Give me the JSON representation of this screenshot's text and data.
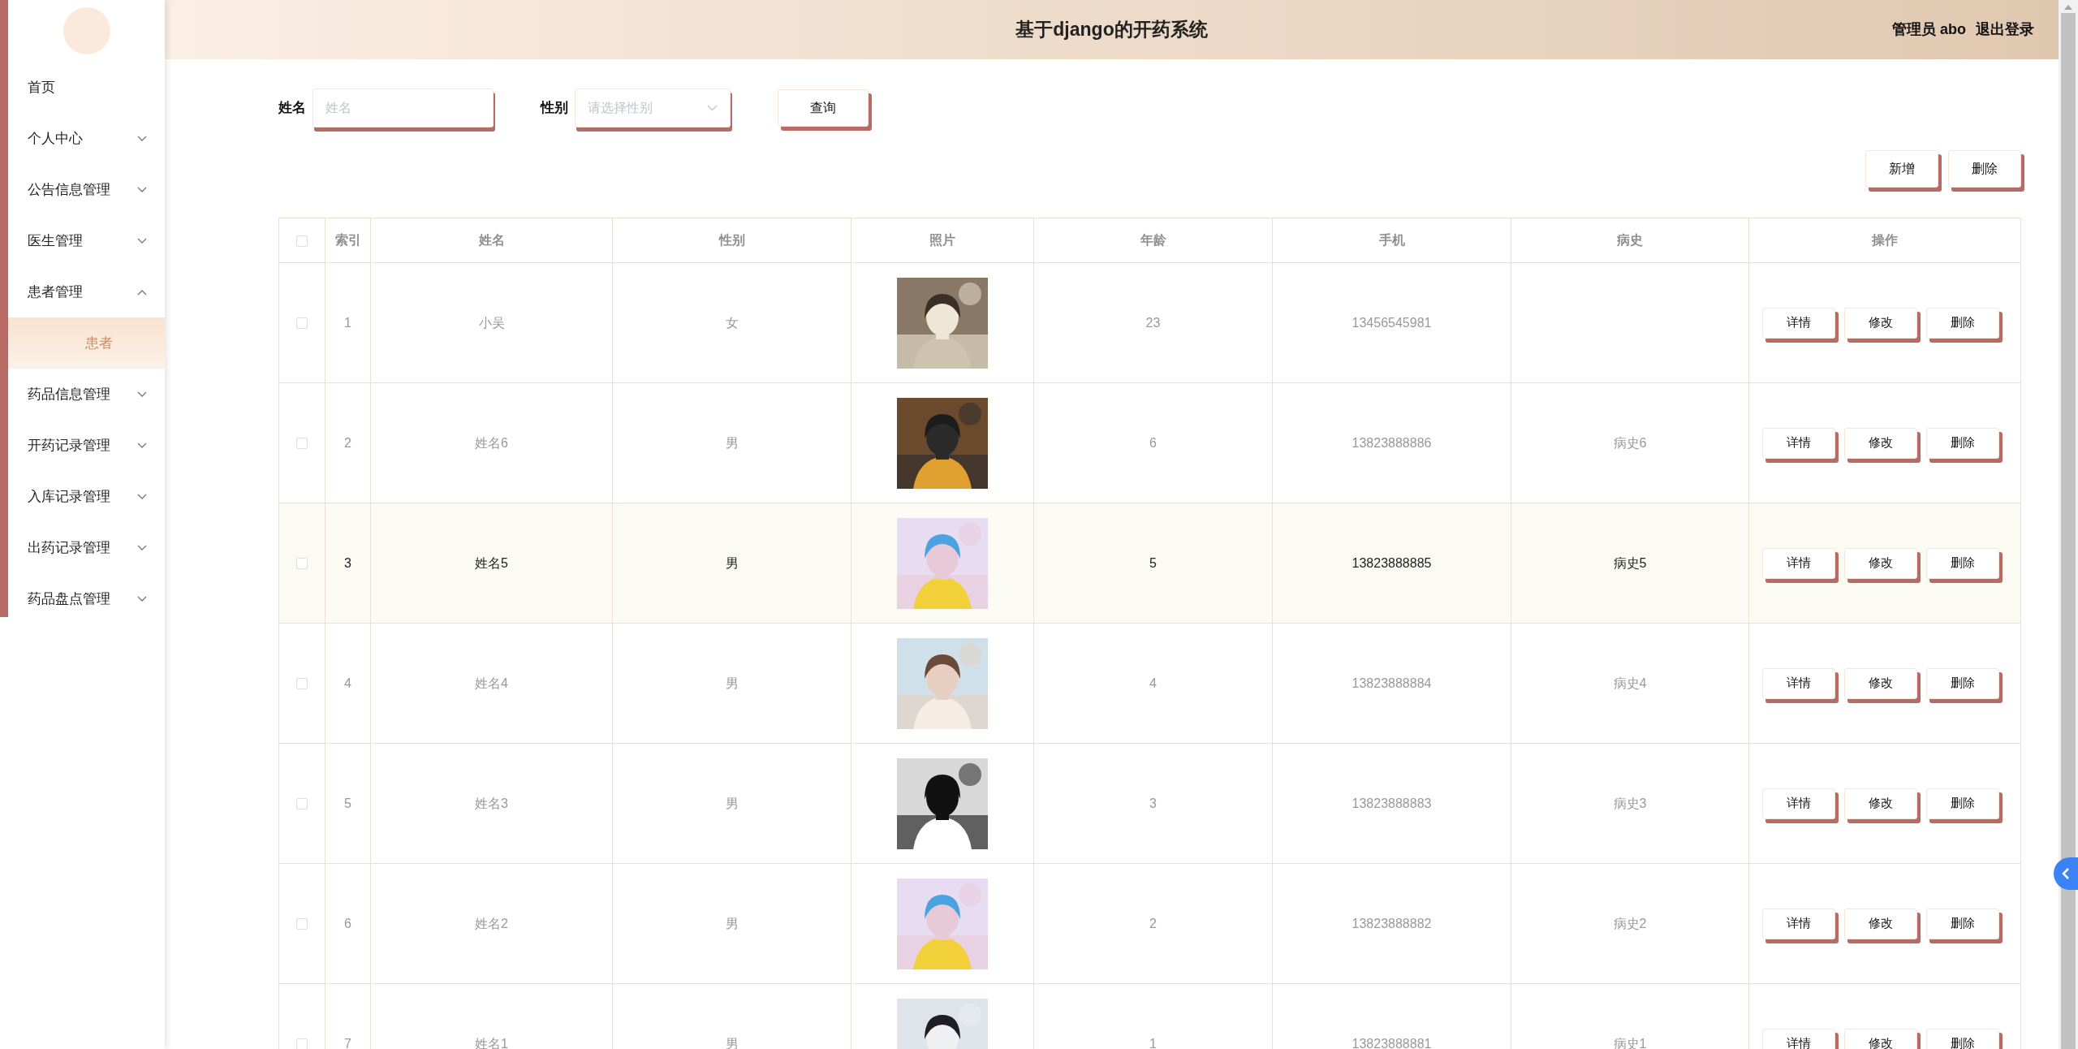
{
  "header": {
    "title": "基于django的开药系统",
    "user": "管理员 abo",
    "logout": "退出登录"
  },
  "sidebar": {
    "items": [
      {
        "label": "首页",
        "kind": "link"
      },
      {
        "label": "个人中心",
        "kind": "menu",
        "expanded": false
      },
      {
        "label": "公告信息管理",
        "kind": "menu",
        "expanded": false
      },
      {
        "label": "医生管理",
        "kind": "menu",
        "expanded": false
      },
      {
        "label": "患者管理",
        "kind": "menu",
        "expanded": true,
        "children": [
          {
            "label": "患者",
            "selected": true
          }
        ]
      },
      {
        "label": "药品信息管理",
        "kind": "menu",
        "expanded": false
      },
      {
        "label": "开药记录管理",
        "kind": "menu",
        "expanded": false
      },
      {
        "label": "入库记录管理",
        "kind": "menu",
        "expanded": false
      },
      {
        "label": "出药记录管理",
        "kind": "menu",
        "expanded": false
      },
      {
        "label": "药品盘点管理",
        "kind": "menu",
        "expanded": false
      }
    ]
  },
  "filters": [
    {
      "label": "姓名",
      "kind": "text",
      "placeholder": "姓名"
    },
    {
      "label": "性别",
      "kind": "select",
      "placeholder": "请选择性别"
    }
  ],
  "search_button": "查询",
  "actions": [
    "新增",
    "删除"
  ],
  "table": {
    "header_checked": false,
    "columns": [
      "索引",
      "姓名",
      "性别",
      "照片",
      "年龄",
      "手机",
      "病史",
      "操作"
    ],
    "rows": [
      {
        "checked": false,
        "hovered": false,
        "index": "1",
        "name": "小吴",
        "gender": "女",
        "age": "23",
        "phone": "13456545981",
        "buttons": [
          "详情",
          "修改",
          "删除"
        ]
      },
      {
        "checked": false,
        "hovered": false,
        "index": "2",
        "name": "姓名6",
        "gender": "男",
        "age": "6",
        "phone": "13823888886",
        "history": "病史6",
        "buttons": [
          "详情",
          "修改",
          "删除"
        ]
      },
      {
        "checked": false,
        "hovered": true,
        "index": "3",
        "name": "姓名5",
        "gender": "男",
        "age": "5",
        "phone": "13823888885",
        "history": "病史5",
        "buttons": [
          "详情",
          "修改",
          "删除"
        ]
      },
      {
        "checked": false,
        "hovered": false,
        "index": "4",
        "name": "姓名4",
        "gender": "男",
        "age": "4",
        "phone": "13823888884",
        "history": "病史4",
        "buttons": [
          "详情",
          "修改",
          "删除"
        ]
      },
      {
        "checked": false,
        "hovered": false,
        "index": "5",
        "name": "姓名3",
        "gender": "男",
        "age": "3",
        "phone": "13823888883",
        "history": "病史3",
        "buttons": [
          "详情",
          "修改",
          "删除"
        ]
      },
      {
        "checked": false,
        "hovered": false,
        "index": "6",
        "name": "姓名2",
        "gender": "男",
        "age": "2",
        "phone": "13823888882",
        "history": "病史2",
        "buttons": [
          "详情",
          "修改",
          "删除"
        ]
      },
      {
        "checked": false,
        "hovered": false,
        "index": "7",
        "name": "姓名1",
        "gender": "男",
        "age": "1",
        "phone": "13823888881",
        "history": "病史1",
        "buttons": [
          "详情",
          "修改",
          "删除"
        ]
      }
    ]
  }
}
